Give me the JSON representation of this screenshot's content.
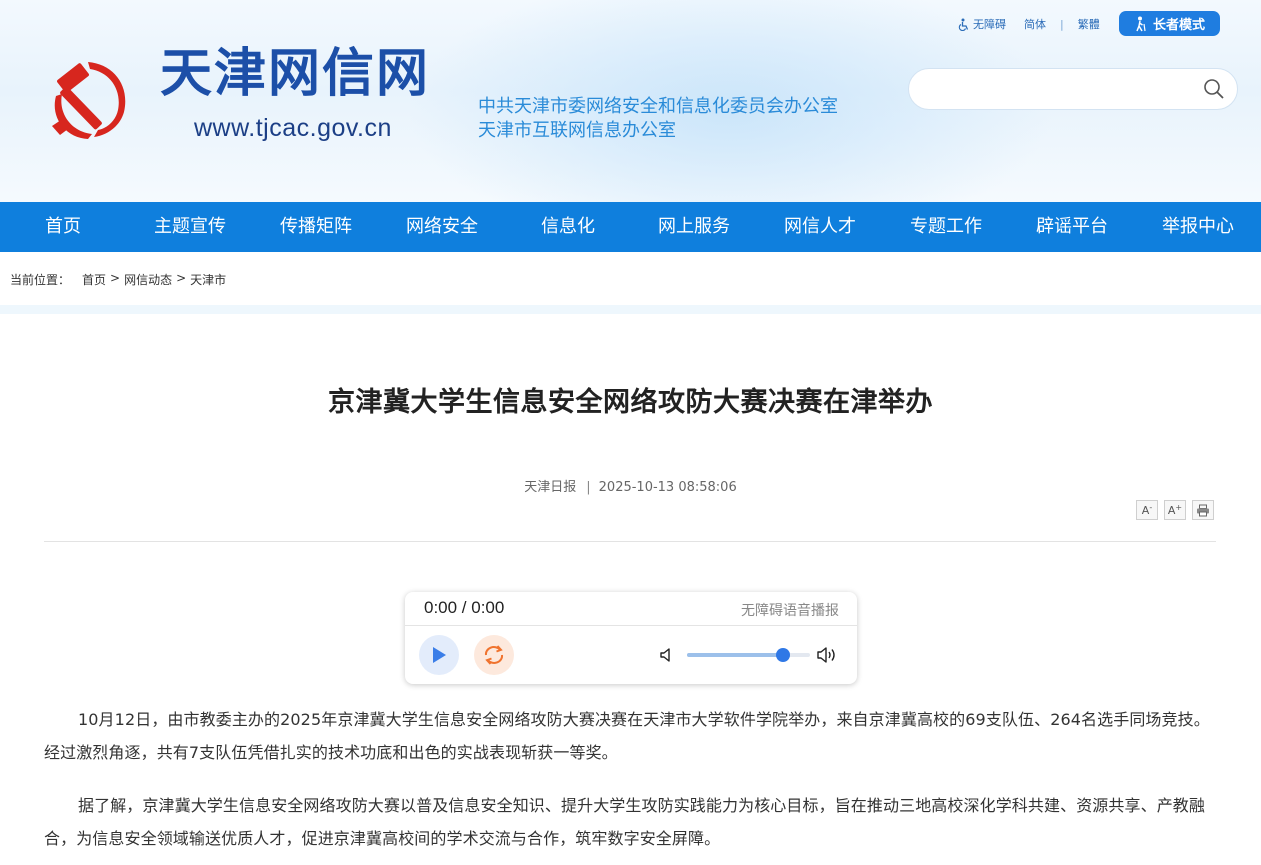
{
  "header": {
    "site_title": "天津网信网",
    "site_url": "www.tjcac.gov.cn",
    "org_line_1": "中共天津市委网络安全和信息化委员会办公室",
    "org_line_2": "天津市互联网信息办公室",
    "accessibility_link": "无障碍",
    "simplified_link": "简体",
    "separator": "|",
    "traditional_link": "繁體",
    "elder_mode_button": "长者模式",
    "search_placeholder": "",
    "emblem_icon": "party-emblem-icon",
    "colors": {
      "brand_blue": "#1c4fa8",
      "emblem_red": "#d7261e",
      "org_text": "#2a8bd8"
    }
  },
  "nav": {
    "color": "#0f7fdd",
    "items": [
      "首页",
      "主题宣传",
      "传播矩阵",
      "网络安全",
      "信息化",
      "网上服务",
      "网信人才",
      "专题工作",
      "辟谣平台",
      "举报中心"
    ]
  },
  "breadcrumb": {
    "label": "当前位置：",
    "items": [
      "首页",
      "网信动态",
      "天津市"
    ],
    "separator": ">"
  },
  "article": {
    "title": "京津冀大学生信息安全网络攻防大赛决赛在津举办",
    "source": "天津日报",
    "meta_separator": "|",
    "datetime": "2025-10-13 08:58:06",
    "tools": {
      "font_decrease": "A",
      "font_increase": "A",
      "decrease_sign": "-",
      "increase_sign": "+",
      "print_icon": "print-icon"
    },
    "paragraphs": [
      "10月12日，由市教委主办的2025年京津冀大学生信息安全网络攻防大赛决赛在天津市大学软件学院举办，来自京津冀高校的69支队伍、264名选手同场竞技。经过激烈角逐，共有7支队伍凭借扎实的技术功底和出色的实战表现斩获一等奖。",
      "据了解，京津冀大学生信息安全网络攻防大赛以普及信息安全知识、提升大学生攻防实践能力为核心目标，旨在推动三地高校深化学科共建、资源共享、产教融合，为信息安全领域输送优质人才，促进京津冀高校间的学术交流与合作，筑牢数字安全屏障。"
    ]
  },
  "player": {
    "time": "0:00 / 0:00",
    "label": "无障碍语音播报",
    "play_icon": "play-icon",
    "loop_icon": "loop-icon",
    "volume_low_icon": "volume-low-icon",
    "volume_high_icon": "volume-high-icon",
    "volume_level": 0.78
  }
}
